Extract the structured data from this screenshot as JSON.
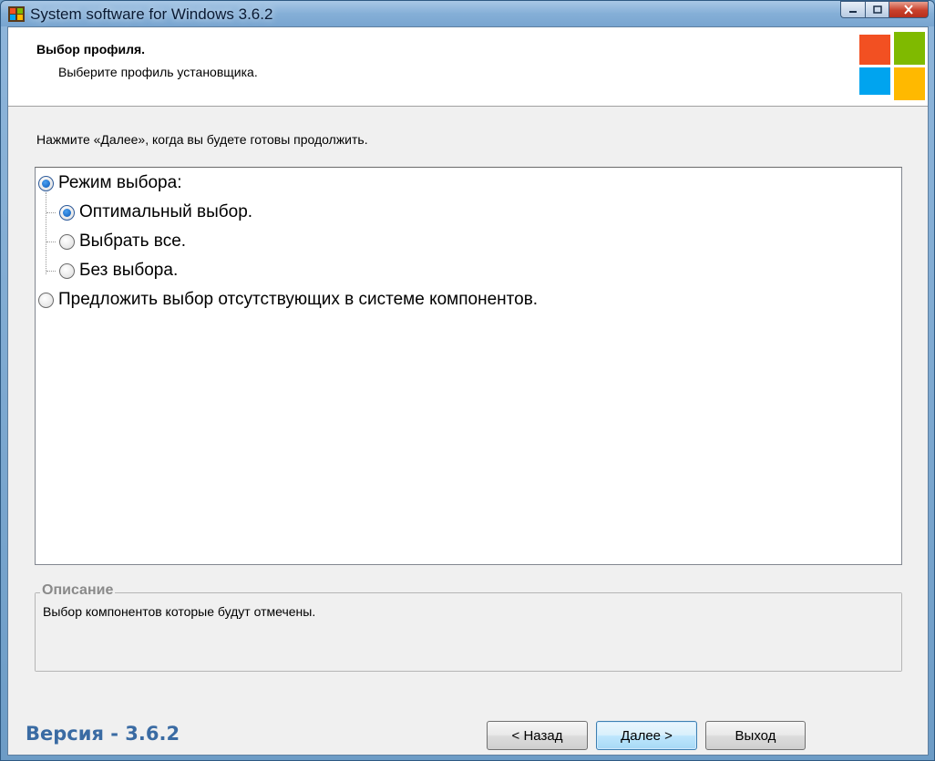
{
  "window": {
    "title": "System software for Windows 3.6.2"
  },
  "header": {
    "title": "Выбор профиля.",
    "subtitle": "Выберите профиль установщика."
  },
  "instruction": "Нажмите «Далее», когда вы будете готовы продолжить.",
  "options": [
    {
      "label": "Режим выбора:",
      "checked": true,
      "level": 0
    },
    {
      "label": "Оптимальный выбор.",
      "checked": true,
      "level": 1
    },
    {
      "label": "Выбрать все.",
      "checked": false,
      "level": 1
    },
    {
      "label": "Без выбора.",
      "checked": false,
      "level": 1
    },
    {
      "label": "Предложить выбор отсутствующих в системе компонентов.",
      "checked": false,
      "level": 0
    }
  ],
  "description": {
    "legend": "Описание",
    "text": "Выбор компонентов которые будут отмечены."
  },
  "footer": {
    "version": "Версия - 3.6.2",
    "back_label": "< Назад",
    "next_label": "Далее >",
    "exit_label": "Выход"
  },
  "colors": {
    "accent_version": "#3a6ba3",
    "logo_red": "#f25022",
    "logo_green": "#7fba00",
    "logo_blue": "#00a4ef",
    "logo_yellow": "#ffb900"
  }
}
